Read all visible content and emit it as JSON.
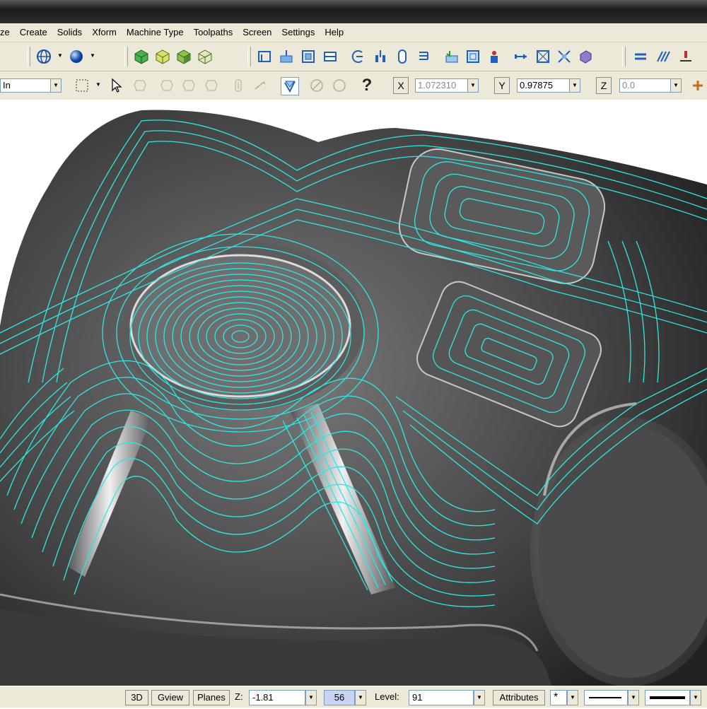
{
  "menu": [
    "ze",
    "Create",
    "Solids",
    "Xform",
    "Machine Type",
    "Toolpaths",
    "Screen",
    "Settings",
    "Help"
  ],
  "toolbar2": {
    "units": "In",
    "help_glyph": "?",
    "x_label": "X",
    "x_value": "1.072310",
    "y_label": "Y",
    "y_value": "0.97875",
    "z_label": "Z",
    "z_value": "0.0"
  },
  "status": {
    "btn_3d": "3D",
    "btn_gview": "Gview",
    "btn_planes": "Planes",
    "z_label": "Z:",
    "z_value": "-1.81",
    "color_value": "56",
    "level_label": "Level:",
    "level_value": "91",
    "attributes": "Attributes",
    "point_style": "*"
  },
  "icons": {
    "toolbar1": [
      "planes-gview-icon",
      "shading-sphere-icon",
      "solid-cube-green-icon",
      "solid-cube-yellow-icon",
      "solid-cube-shaded-icon",
      "wireframe-cube-icon",
      "toolpath-contour-icon",
      "toolpath-pocket-icon",
      "toolpath-surface-rough-icon",
      "toolpath-surface-finish-icon",
      "toolpath-drill-icon",
      "toolpath-circle-icon",
      "toolpath-slot-icon",
      "toolpath-thread-icon",
      "operations-manager-icon",
      "backplot-icon",
      "verify-icon",
      "transform-icon",
      "multiaxis-icon",
      "nesting-icon",
      "stock-icon",
      "line-style-icon",
      "hatch-icon",
      "dimension-icon"
    ],
    "toolbar2": [
      "select-box-icon",
      "cursor-arrow-icon",
      "solid-select-icon",
      "chain-icon",
      "verify-check-icon",
      "no-entry-icon",
      "help-icon"
    ]
  },
  "colors": {
    "toolpath": "#2ee6e6",
    "part": "#5a5a5a",
    "chrome": "#ece9d8"
  }
}
